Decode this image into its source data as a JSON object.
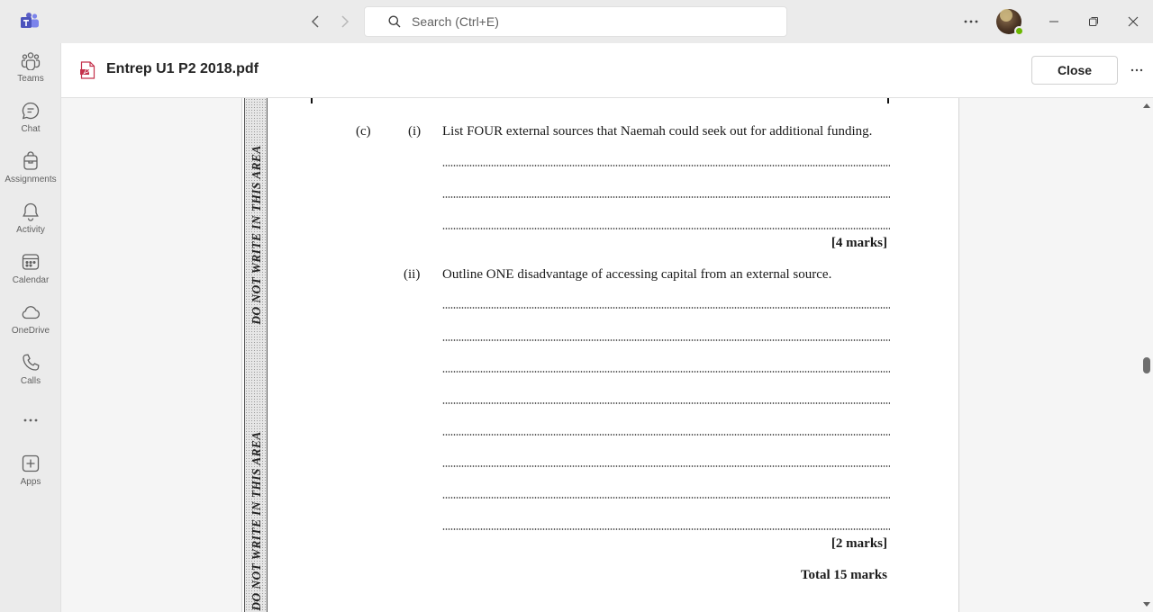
{
  "titlebar": {
    "search_placeholder": "Search (Ctrl+E)"
  },
  "rail": {
    "items": [
      {
        "label": "Teams",
        "icon": "teams-icon"
      },
      {
        "label": "Chat",
        "icon": "chat-icon"
      },
      {
        "label": "Assignments",
        "icon": "assignments-icon"
      },
      {
        "label": "Activity",
        "icon": "bell-icon"
      },
      {
        "label": "Calendar",
        "icon": "calendar-icon"
      },
      {
        "label": "OneDrive",
        "icon": "cloud-icon"
      },
      {
        "label": "Calls",
        "icon": "phone-icon"
      },
      {
        "label": "",
        "icon": "more-icon"
      },
      {
        "label": "Apps",
        "icon": "add-app-icon"
      }
    ]
  },
  "document": {
    "title": "Entrep U1 P2 2018.pdf",
    "close_label": "Close"
  },
  "page": {
    "margin_text": "DO NOT WRITE IN THIS AREA",
    "part_label": "(c)",
    "q1": {
      "num": "(i)",
      "text": "List FOUR external sources that Naemah could seek out for additional funding.",
      "marks": "[4 marks]"
    },
    "q2": {
      "num": "(ii)",
      "text": "Outline ONE disadvantage of accessing capital from an external source.",
      "marks": "[2 marks]"
    },
    "total": "Total 15 marks"
  },
  "colors": {
    "chrome": "#ebebeb",
    "presence": "#6bb700",
    "teams_brand": "#5b5fc7",
    "pdf_red": "#c4314b"
  }
}
